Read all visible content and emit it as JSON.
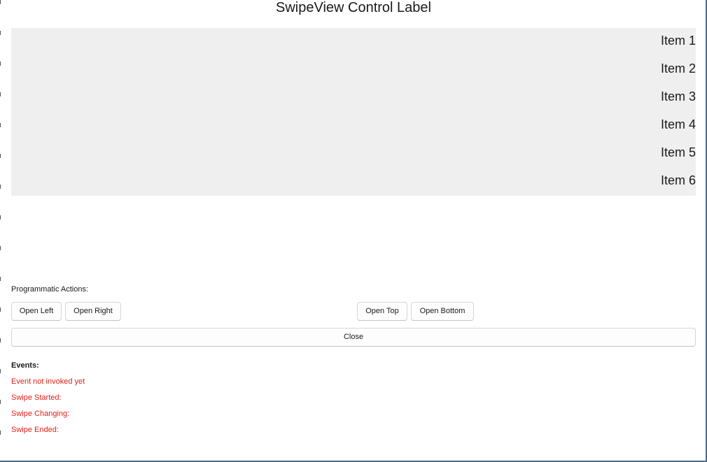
{
  "title": "SwipeView Control Label",
  "swipe_view": {
    "items": [
      "Item 1",
      "Item 2",
      "Item 3",
      "Item 4",
      "Item 5",
      "Item 6"
    ]
  },
  "actions": {
    "label": "Programmatic Actions:",
    "open_left": "Open Left",
    "open_right": "Open Right",
    "open_top": "Open Top",
    "open_bottom": "Open Bottom",
    "close": "Close"
  },
  "events": {
    "header": "Events:",
    "status": "Event not invoked yet",
    "swipe_started": "Swipe Started:",
    "swipe_changing": "Swipe Changing:",
    "swipe_ended": "Swipe Ended:"
  },
  "colors": {
    "event_text": "#e0201a",
    "swipe_background": "#efefef",
    "window_border": "#4a6b86"
  }
}
